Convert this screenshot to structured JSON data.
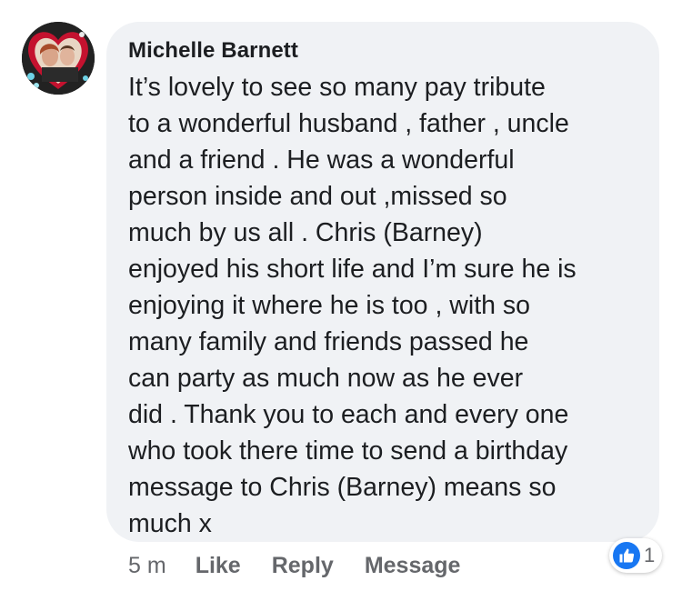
{
  "comment": {
    "author": "Michelle Barnett",
    "text": "It’s lovely to see so many pay tribute\nto a wonderful husband , father , uncle\nand a friend . He was a wonderful\nperson inside and out ,missed so\nmuch by us all . Chris (Barney)\nenjoyed his short life and I’m sure he is\nenjoying it where he is too , with so\nmany family and friends passed he\ncan party as much now as he ever\ndid . Thank you to each and every one\nwho took there time to send a birthday\nmessage to Chris (Barney) means so\nmuch x"
  },
  "actions": {
    "time": "5 m",
    "like": "Like",
    "reply": "Reply",
    "message": "Message"
  },
  "reactions": {
    "icon": "like-icon",
    "count": "1"
  },
  "colors": {
    "bubble": "#f0f2f5",
    "like_blue": "#1877f2",
    "secondary_text": "#65676b"
  }
}
